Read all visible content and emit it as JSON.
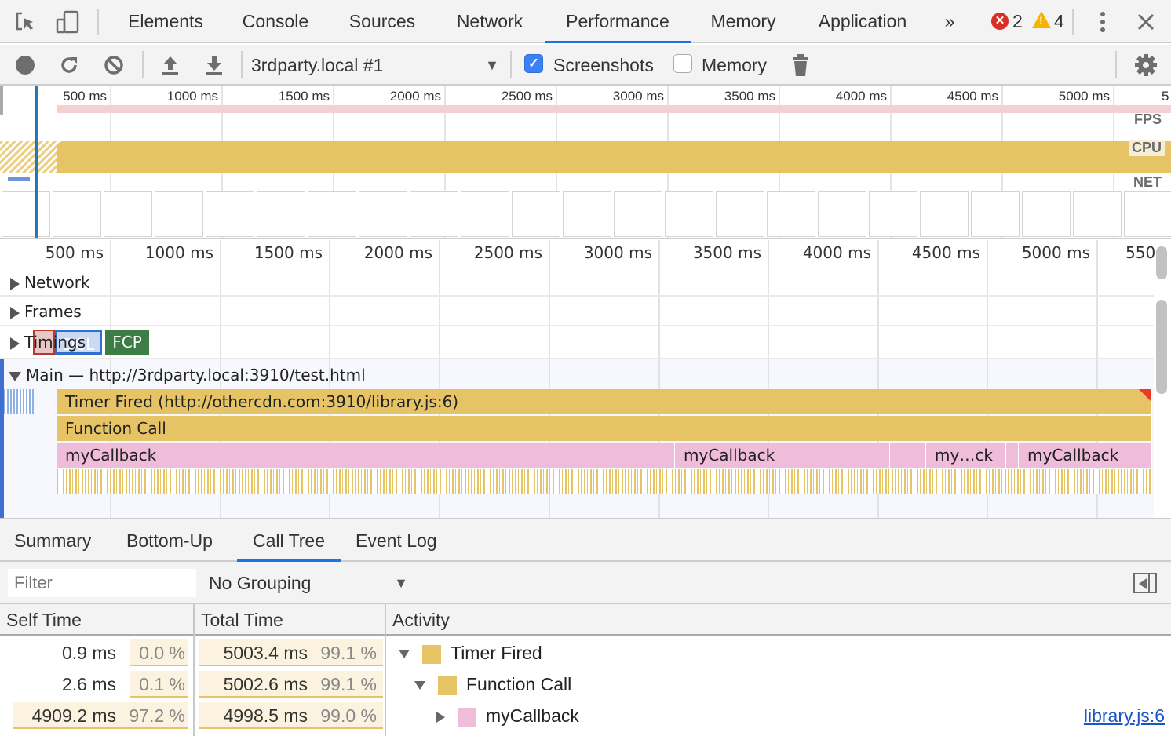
{
  "devtools": {
    "tabs": [
      {
        "label": "Elements",
        "active": false
      },
      {
        "label": "Console",
        "active": false
      },
      {
        "label": "Sources",
        "active": false
      },
      {
        "label": "Network",
        "active": false
      },
      {
        "label": "Performance",
        "active": true
      },
      {
        "label": "Memory",
        "active": false
      },
      {
        "label": "Application",
        "active": false
      }
    ],
    "more_tabs": "»",
    "error_count": "2",
    "warning_count": "4",
    "icons": {
      "inspect": "inspect-element-icon",
      "device": "device-toolbar-icon",
      "more": "kebab-menu-icon",
      "close": "close-icon"
    }
  },
  "toolbar": {
    "profile": "3rdparty.local #1",
    "screenshots_label": "Screenshots",
    "screenshots_checked": true,
    "memory_label": "Memory",
    "memory_checked": false
  },
  "overview": {
    "ticks": [
      "500 ms",
      "1000 ms",
      "1500 ms",
      "2000 ms",
      "2500 ms",
      "3000 ms",
      "3500 ms",
      "4000 ms",
      "4500 ms",
      "5000 ms",
      "5"
    ],
    "labels": {
      "fps": "FPS",
      "cpu": "CPU",
      "net": "NET"
    }
  },
  "flame": {
    "ticks": [
      "500 ms",
      "1000 ms",
      "1500 ms",
      "2000 ms",
      "2500 ms",
      "3000 ms",
      "3500 ms",
      "4000 ms",
      "4500 ms",
      "5000 ms",
      "550"
    ],
    "tracks": {
      "network": "Network",
      "frames": "Frames",
      "timings": "Timings",
      "main": "Main — http://3rdparty.local:3910/test.html"
    },
    "timing_markers": {
      "dcl": "DCL",
      "fcp": "FCP"
    },
    "events": {
      "timer": "Timer Fired (http://othercdn.com:3910/library.js:6)",
      "function_call": "Function Call",
      "callbacks": [
        "myCallback",
        "myCallback",
        "my…ck",
        "myCallback"
      ]
    }
  },
  "bottom": {
    "tabs": [
      {
        "label": "Summary",
        "active": false
      },
      {
        "label": "Bottom-Up",
        "active": false
      },
      {
        "label": "Call Tree",
        "active": true
      },
      {
        "label": "Event Log",
        "active": false
      }
    ],
    "filter_placeholder": "Filter",
    "grouping": "No Grouping",
    "columns": {
      "self": "Self Time",
      "total": "Total Time",
      "activity": "Activity"
    },
    "rows": [
      {
        "self_time": "0.9 ms",
        "self_pct": "0.0 %",
        "total_time": "5003.4 ms",
        "total_pct": "99.1 %",
        "activity": "Timer Fired",
        "color": "#e6c466",
        "expanded": true,
        "link": ""
      },
      {
        "self_time": "2.6 ms",
        "self_pct": "0.1 %",
        "total_time": "5002.6 ms",
        "total_pct": "99.1 %",
        "activity": "Function Call",
        "color": "#e6c466",
        "expanded": true,
        "link": ""
      },
      {
        "self_time": "4909.2 ms",
        "self_pct": "97.2 %",
        "total_time": "4998.5 ms",
        "total_pct": "99.0 %",
        "activity": "myCallback",
        "color": "#efbcd9",
        "expanded": false,
        "link": "library.js:6"
      }
    ]
  }
}
